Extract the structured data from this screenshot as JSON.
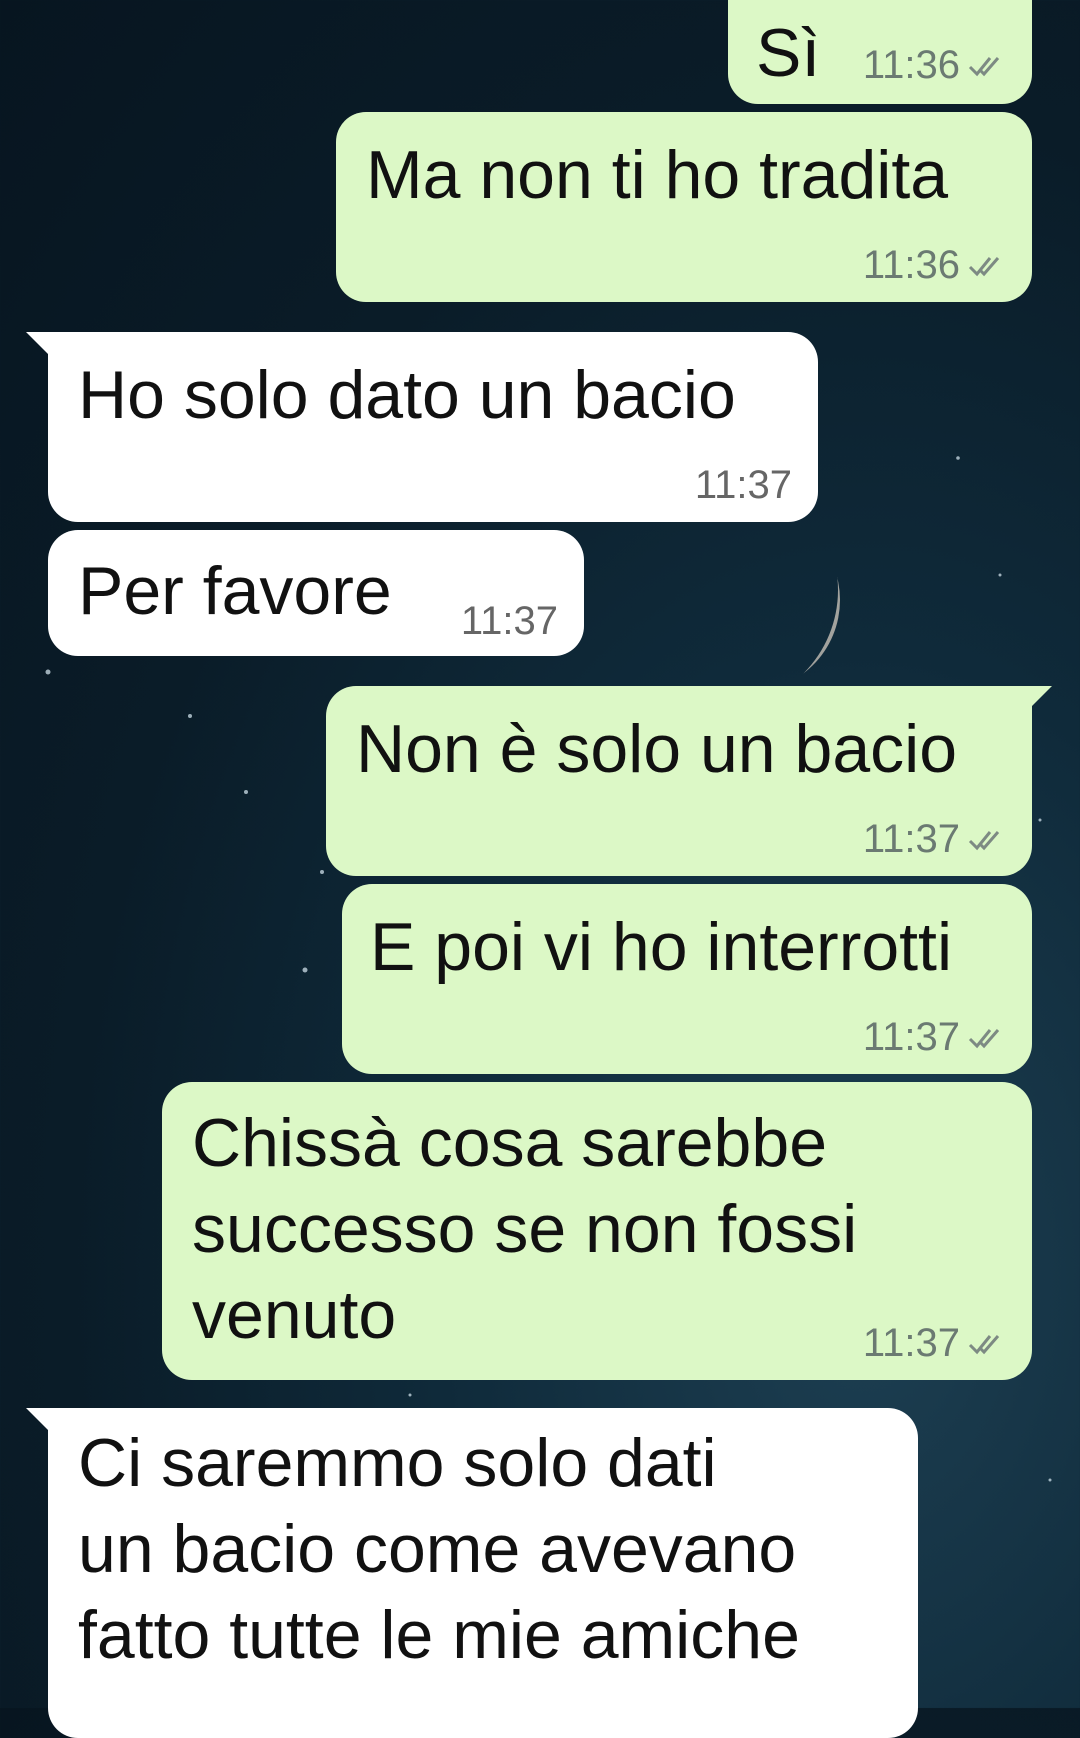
{
  "chat": {
    "messages": [
      {
        "direction": "out",
        "text": "Sì",
        "time": "11:36",
        "status": "read-ticks-icon"
      },
      {
        "direction": "out",
        "text": "Ma non ti ho tradita",
        "time": "11:36",
        "status": "read-ticks-icon"
      },
      {
        "direction": "in",
        "text": "Ho solo dato un bacio",
        "time": "11:37"
      },
      {
        "direction": "in",
        "text": "Per favore",
        "time": "11:37"
      },
      {
        "direction": "out",
        "text": "Non è solo un bacio",
        "time": "11:37",
        "status": "read-ticks-icon"
      },
      {
        "direction": "out",
        "text": "E poi vi ho interrotti",
        "time": "11:37",
        "status": "read-ticks-icon"
      },
      {
        "direction": "out",
        "lines": [
          "Chissà cosa sarebbe",
          "successo se non fossi",
          "venuto"
        ],
        "time": "11:37",
        "status": "read-ticks-icon"
      },
      {
        "direction": "in",
        "lines": [
          "Ci saremmo solo dati",
          "un bacio come avevano",
          "fatto tutte le mie amiche"
        ]
      }
    ]
  },
  "colors": {
    "outgoing_bubble": "#dcf8c6",
    "incoming_bubble": "#ffffff",
    "background": "#0b1d2a",
    "timestamp": "#6b7a72"
  }
}
